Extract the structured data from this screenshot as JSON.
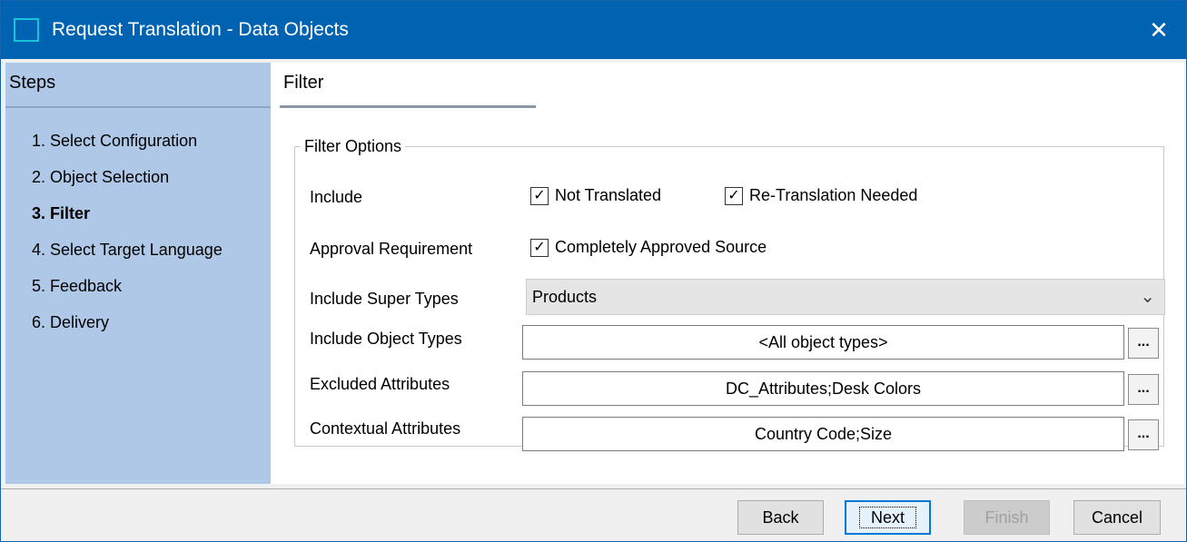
{
  "window": {
    "title": "Request Translation - Data Objects",
    "close_glyph": "✕",
    "accent": "#0063b1"
  },
  "sidebar": {
    "title": "Steps",
    "background": "#b0c8e8",
    "steps": [
      {
        "label": "1. Select Configuration"
      },
      {
        "label": "2. Object Selection"
      },
      {
        "label": "3. Filter",
        "active": true
      },
      {
        "label": "4. Select Target Language"
      },
      {
        "label": "5. Feedback"
      },
      {
        "label": "6. Delivery"
      }
    ]
  },
  "main": {
    "section_title": "Filter",
    "filter_options": {
      "legend": "Filter Options",
      "include": {
        "label": "Include",
        "not_translated": {
          "label": "Not Translated",
          "checked": true
        },
        "re_translation": {
          "label": "Re-Translation Needed",
          "checked": true
        }
      },
      "approval": {
        "label": "Approval Requirement",
        "completely_approved": {
          "label": "Completely Approved Source",
          "checked": true
        }
      },
      "super_types": {
        "label": "Include Super Types",
        "value": "Products",
        "icon": "chevron-down-icon"
      },
      "object_types": {
        "label": "Include Object Types",
        "value": "<All object types>",
        "browse": "..."
      },
      "excluded_attributes": {
        "label": "Excluded Attributes",
        "value": "DC_Attributes;Desk Colors",
        "browse": "..."
      },
      "contextual_attributes": {
        "label": "Contextual Attributes",
        "value": "Country Code;Size",
        "browse": "..."
      }
    }
  },
  "footer": {
    "back": "Back",
    "next": "Next",
    "finish": "Finish",
    "cancel": "Cancel"
  }
}
